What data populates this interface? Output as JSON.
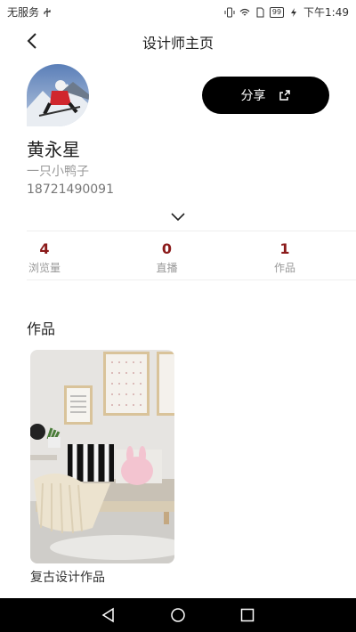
{
  "status_bar": {
    "carrier": "无服务",
    "battery": "99",
    "time": "下午1:49"
  },
  "header": {
    "title": "设计师主页",
    "back_icon": "back-chevron-icon"
  },
  "profile": {
    "name": "黄永星",
    "nickname": "一只小鸭子",
    "phone": "18721490091",
    "share_label": "分享",
    "share_icon": "share-icon"
  },
  "stats": [
    {
      "value": "4",
      "label": "浏览量"
    },
    {
      "value": "0",
      "label": "直播"
    },
    {
      "value": "1",
      "label": "作品"
    }
  ],
  "works": {
    "section_title": "作品",
    "items": [
      {
        "title": "复古设计作品"
      }
    ]
  },
  "colors": {
    "accent": "#8b1a1a",
    "button_bg": "#000000"
  }
}
